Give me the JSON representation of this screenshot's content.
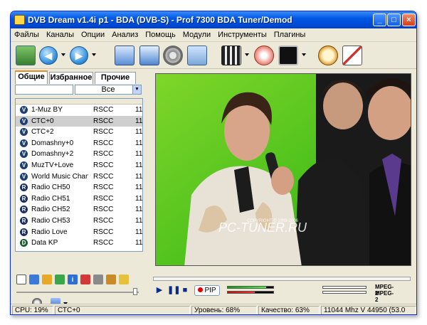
{
  "window": {
    "title": "DVB Dream v1.4i p1 - BDA (DVB-S)  -  Prof 7300 BDA Tuner/Demod"
  },
  "menu": [
    "Файлы",
    "Каналы",
    "Опции",
    "Анализ",
    "Помощь",
    "Модули",
    "Инструменты",
    "Плагины"
  ],
  "tabs": [
    "Общие",
    "Избранное",
    "Прочие"
  ],
  "filter": {
    "input_value": "",
    "combo_value": "Все"
  },
  "channels": [
    {
      "name": "1-Muz BY",
      "sat": "RSCC",
      "freq": "11",
      "icon": "V",
      "selected": false
    },
    {
      "name": "СТС+0",
      "sat": "RSCC",
      "freq": "11",
      "icon": "V",
      "selected": true
    },
    {
      "name": "СТС+2",
      "sat": "RSCC",
      "freq": "11",
      "icon": "V",
      "selected": false
    },
    {
      "name": "Domashny+0",
      "sat": "RSCC",
      "freq": "11",
      "icon": "V",
      "selected": false
    },
    {
      "name": "Domashny+2",
      "sat": "RSCC",
      "freq": "11",
      "icon": "V",
      "selected": false
    },
    {
      "name": "MuzTV+Love",
      "sat": "RSCC",
      "freq": "11",
      "icon": "V",
      "selected": false
    },
    {
      "name": "World Music Chan...",
      "sat": "RSCC",
      "freq": "11",
      "icon": "V",
      "selected": false
    },
    {
      "name": "Radio CH50",
      "sat": "RSCC",
      "freq": "11",
      "icon": "R",
      "selected": false
    },
    {
      "name": "Radio CH51",
      "sat": "RSCC",
      "freq": "11",
      "icon": "R",
      "selected": false
    },
    {
      "name": "Radio CH52",
      "sat": "RSCC",
      "freq": "11",
      "icon": "R",
      "selected": false
    },
    {
      "name": "Radio CH53",
      "sat": "RSCC",
      "freq": "11",
      "icon": "R",
      "selected": false
    },
    {
      "name": "Radio Love",
      "sat": "RSCC",
      "freq": "11",
      "icon": "R",
      "selected": false
    },
    {
      "name": "Data KP",
      "sat": "RSCC",
      "freq": "11",
      "icon": "D",
      "selected": false
    }
  ],
  "video": {
    "watermark": "PC-TUNER.RU",
    "copyright": "COPYRIGHT © 1999-2006"
  },
  "player": {
    "pip_label": "PIP",
    "codec_video": "MPEG-2",
    "codec_audio": "MPEG-2",
    "meter1_level": 0.85,
    "meter2_level": 0.6
  },
  "status": {
    "cpu": "CPU: 19%",
    "channel": "СТС+0",
    "level": "Уровень: 68%",
    "quality": "Качество: 63%",
    "tuning": "11044 Mhz  V  44950  (53.0"
  }
}
